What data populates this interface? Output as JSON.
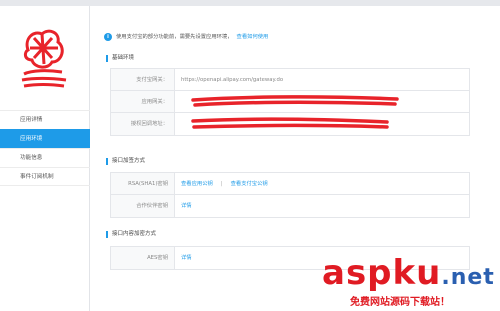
{
  "sidebar": {
    "items": [
      {
        "label": "应用详情",
        "active": false
      },
      {
        "label": "应用环境",
        "active": true
      },
      {
        "label": "功能信息",
        "active": false
      },
      {
        "label": "事件订阅机制",
        "active": false
      }
    ]
  },
  "notice": {
    "text": "使用支付宝的部分功能前，需要先设置应用环境，",
    "link": "查看如何使用"
  },
  "sections": {
    "basic": {
      "title": "基础环境",
      "rows": [
        {
          "label": "支付宝网关：",
          "value": "https://openapi.alipay.com/gateway.do"
        },
        {
          "label": "应用网关：",
          "value": ""
        },
        {
          "label": "授权回调地址：",
          "value": ""
        }
      ]
    },
    "sign": {
      "title": "接口加签方式",
      "rows": [
        {
          "label": "RSA(SHA1)密钥",
          "link1": "查看应用公钥",
          "separator": "|",
          "link2": "查看支付宝公钥"
        },
        {
          "label": "合作伙伴密钥",
          "link1": "详情"
        }
      ]
    },
    "encrypt": {
      "title": "接口内容加密方式",
      "rows": [
        {
          "label": "AES密钥",
          "link1": "详情"
        }
      ]
    }
  },
  "watermark": {
    "brand": "aspku",
    "domain": ".net",
    "tagline": "免费网站源码下载站！"
  },
  "colors": {
    "accent": "#1e9be8",
    "redaction": "#e8232a",
    "watermark_red": "#e01b23",
    "watermark_blue": "#2a5fb0"
  }
}
